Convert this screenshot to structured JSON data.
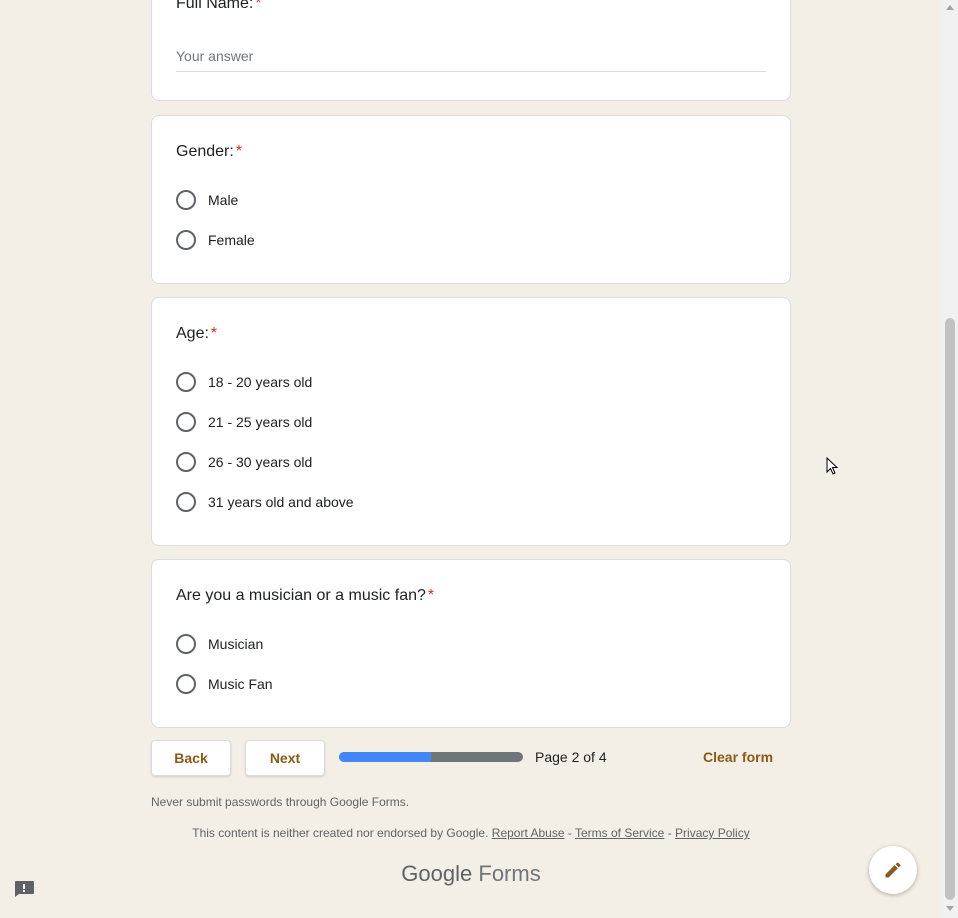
{
  "form": {
    "questions": [
      {
        "title": "Full Name:",
        "required_mark": "*",
        "placeholder": "Your answer"
      },
      {
        "title": "Gender:",
        "required_mark": "*",
        "options": [
          "Male",
          "Female"
        ]
      },
      {
        "title": "Age:",
        "required_mark": "*",
        "options": [
          "18 - 20 years old",
          "21 - 25 years old",
          "26 - 30 years old",
          "31 years old and above"
        ]
      },
      {
        "title": "Are you a musician or a music fan?",
        "required_mark": "*",
        "options": [
          "Musician",
          "Music Fan"
        ]
      }
    ]
  },
  "nav": {
    "back_label": "Back",
    "next_label": "Next",
    "page_indicator": "Page 2 of 4",
    "progress_fraction": 0.5,
    "clear_label": "Clear form"
  },
  "footer": {
    "never_submit": "Never submit passwords through Google Forms.",
    "disclaimer": "This content is neither created nor endorsed by Google.",
    "sep": "-",
    "report_abuse": "Report Abuse",
    "terms": "Terms of Service",
    "privacy": "Privacy Policy",
    "brand_google": "Google",
    "brand_forms": "Forms"
  },
  "icons": {
    "edit": "pencil-icon",
    "report": "report-problem-icon"
  },
  "colors": {
    "background": "#f4efe6",
    "accent": "#8a5a18",
    "required": "#d93025",
    "progress": "#4285f4"
  }
}
